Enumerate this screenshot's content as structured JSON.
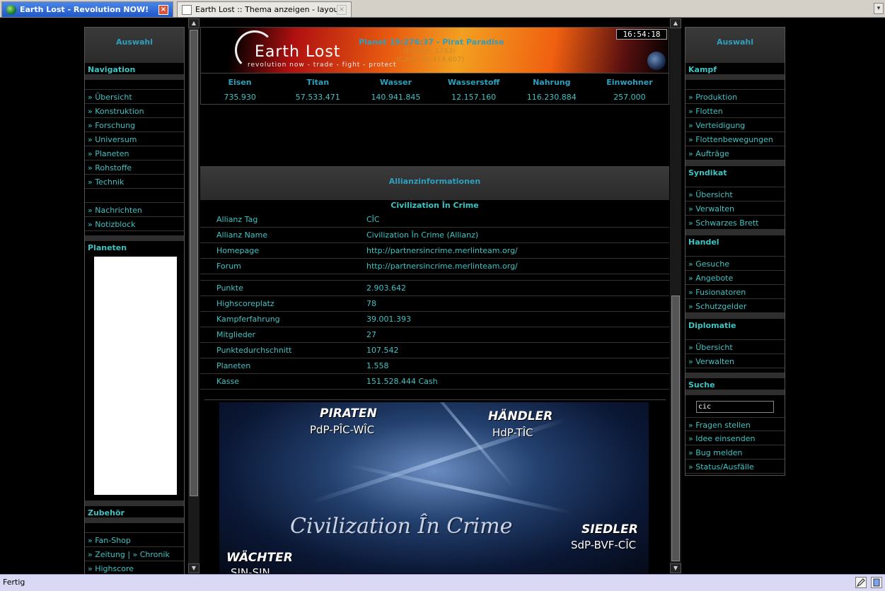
{
  "browser": {
    "tabs": [
      {
        "label": "Earth Lost - Revolution NOW!",
        "active": true
      },
      {
        "label": "Earth Lost :: Thema anzeigen - layout ...",
        "active": false
      }
    ],
    "close_glyph": "×",
    "tab_scroll_glyph": "▾",
    "status": "Fertig"
  },
  "left": {
    "header": "Auswahl",
    "nav_title": "Navigation",
    "nav_items": [
      "» Übersicht",
      "» Konstruktion",
      "» Forschung",
      "» Universum",
      "» Planeten",
      "» Rohstoffe",
      "» Technik"
    ],
    "msg_items": [
      "» Nachrichten",
      "» Notizblock"
    ],
    "planets_title": "Planeten",
    "extras_title": "Zubehör",
    "extras_items": [
      "» Fan-Shop",
      "» Zeitung | » Chronik",
      "» Highscore"
    ]
  },
  "right": {
    "header": "Auswahl",
    "kampf_title": "Kampf",
    "kampf_items": [
      "» Produktion",
      "» Flotten",
      "» Verteidigung",
      "» Flottenbewegungen",
      "» Aufträge"
    ],
    "syndikat_title": "Syndikat",
    "syndikat_items": [
      "» Übersicht",
      "» Verwalten",
      "» Schwarzes Brett"
    ],
    "handel_title": "Handel",
    "handel_items": [
      "» Gesuche",
      "» Angebote",
      "» Fusionatoren",
      "» Schutzgelder"
    ],
    "diplomatie_title": "Diplomatie",
    "diplomatie_items": [
      "» Übersicht",
      "» Verwalten"
    ],
    "suche_title": "Suche",
    "search_value": "cic",
    "suche_items": [
      "» Fragen stellen",
      "» Idee einsenden",
      "» Bug melden",
      "» Status/Ausfälle"
    ]
  },
  "banner": {
    "logo": "Earth Lost",
    "tagline": "revolution now - trade - fight - protect",
    "planet": "Planet 19:276:37 - Pirat Paradise",
    "points": "(Punkte: 1763)",
    "cash": "(Cash: 11.414.607)",
    "clock": "16:54:18"
  },
  "resources": {
    "headers": [
      "Eisen",
      "Titan",
      "Wasser",
      "Wasserstoff",
      "Nahrung",
      "Einwohner"
    ],
    "values": [
      "735.930",
      "57.533.471",
      "140.941.845",
      "12.157.160",
      "116.230.884",
      "257.000"
    ]
  },
  "alliance": {
    "heading": "Allianzinformationen",
    "name": "Civilization În Crime",
    "rows_a": [
      {
        "k": "Allianz Tag",
        "v": "CÎC"
      },
      {
        "k": "Allianz Name",
        "v": "Civilization În Crime (Allianz)"
      },
      {
        "k": "Homepage",
        "v": "http://partnersincrime.merlinteam.org/"
      },
      {
        "k": "Forum",
        "v": "http://partnersincrime.merlinteam.org/"
      }
    ],
    "rows_b": [
      {
        "k": "Punkte",
        "v": "2.903.642"
      },
      {
        "k": "Highscoreplatz",
        "v": "78"
      },
      {
        "k": "Kampferfahrung",
        "v": "39.001.393"
      },
      {
        "k": "Mitglieder",
        "v": "27"
      },
      {
        "k": "Punktedurchschnitt",
        "v": "107.542"
      },
      {
        "k": "Planeten",
        "v": "1.558"
      },
      {
        "k": "Kasse",
        "v": "151.528.444 Cash"
      }
    ]
  },
  "alliance_image": {
    "piraten": "PIRATEN",
    "piraten_sub": "PdP-PÎC-WÎC",
    "haendler": "HÄNDLER",
    "haendler_sub": "HdP-TÎC",
    "siedler": "SIEDLER",
    "siedler_sub": "SdP-BVF-CÎC",
    "waechter": "WÄCHTER",
    "waechter_sub": "SIN-SIN",
    "big_title": "Civilization În Crime"
  }
}
